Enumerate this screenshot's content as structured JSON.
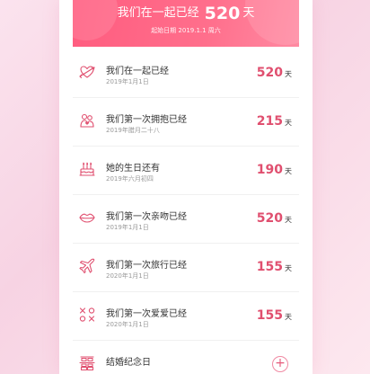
{
  "header": {
    "prefix": "我们在一起已经",
    "days": "520",
    "unit": "天",
    "subtitle": "起始日期 2019.1.1 周六"
  },
  "colors": {
    "accent": "#e04f6f",
    "header_gradient_start": "#ff5c7f",
    "header_gradient_end": "#ff8aa2"
  },
  "anniversaries": [
    {
      "icon": "heart-arrow-icon",
      "title": "我们在一起已经",
      "date": "2019年1月1日",
      "days": "520",
      "unit": "天"
    },
    {
      "icon": "couple-hug-icon",
      "title": "我们第一次拥抱已经",
      "date": "2019年腊月二十八",
      "days": "215",
      "unit": "天"
    },
    {
      "icon": "birthday-cake-icon",
      "title": "她的生日还有",
      "date": "2019年六月初四",
      "days": "190",
      "unit": "天"
    },
    {
      "icon": "lips-icon",
      "title": "我们第一次亲吻已经",
      "date": "2019年1月1日",
      "days": "520",
      "unit": "天"
    },
    {
      "icon": "airplane-icon",
      "title": "我们第一次旅行已经",
      "date": "2020年1月1日",
      "days": "155",
      "unit": "天"
    },
    {
      "icon": "xoxo-icon",
      "title": "我们第一次爱爱已经",
      "date": "2020年1月1日",
      "days": "155",
      "unit": "天"
    }
  ],
  "wedding": {
    "icon": "double-happiness-icon",
    "title": "结婚纪念日",
    "add_icon": "plus-icon"
  }
}
